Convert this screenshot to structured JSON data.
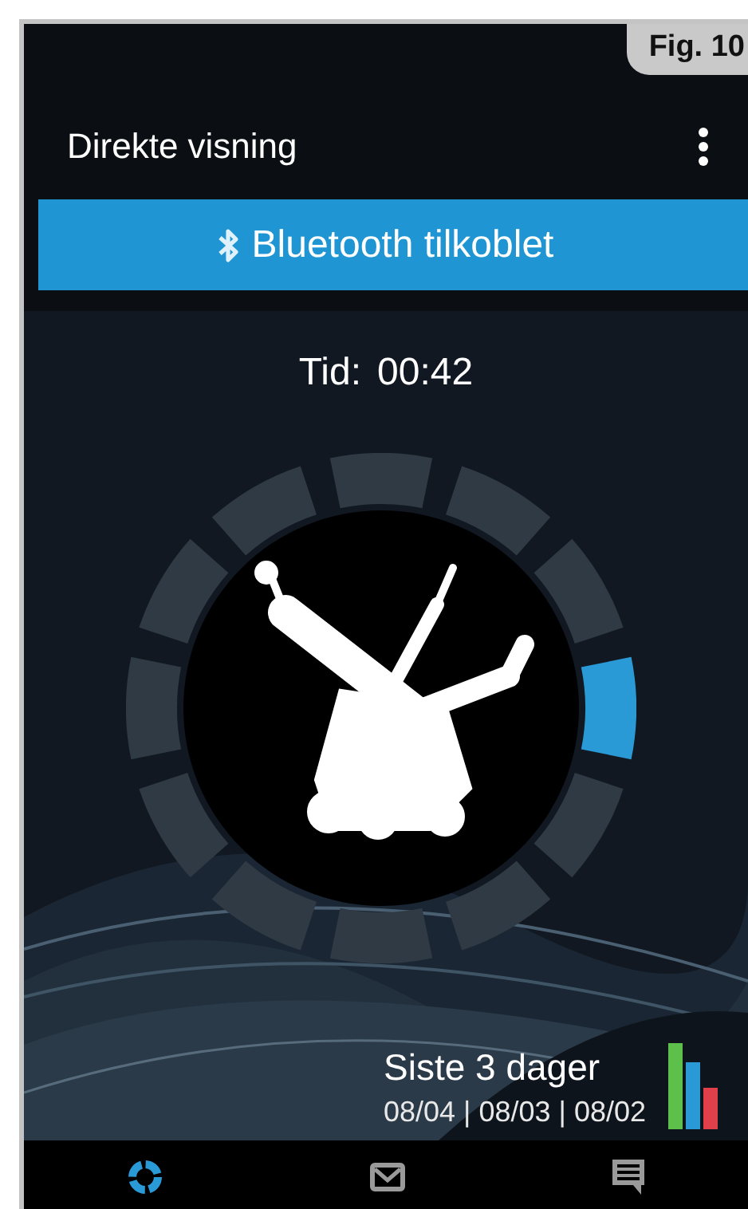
{
  "figure_label": "Fig. 10",
  "app_bar": {
    "title": "Direkte visning"
  },
  "status_banner": {
    "text": "Bluetooth tilkoblet"
  },
  "timer": {
    "label": "Tid:",
    "value": "00:42"
  },
  "tilt_ring": {
    "segments": [
      {
        "on": false
      },
      {
        "on": false
      },
      {
        "on": false
      },
      {
        "on": true
      },
      {
        "on": false
      },
      {
        "on": false
      },
      {
        "on": false
      },
      {
        "on": false
      },
      {
        "on": false
      },
      {
        "on": false
      },
      {
        "on": false
      },
      {
        "on": false
      }
    ]
  },
  "history": {
    "title": "Siste 3 dager",
    "dates": "08/04 | 08/03 | 08/02"
  },
  "bottom_nav": [
    {
      "kind": "ring",
      "selected": true
    },
    {
      "kind": "mail",
      "selected": false
    },
    {
      "kind": "chat",
      "selected": false
    }
  ]
}
